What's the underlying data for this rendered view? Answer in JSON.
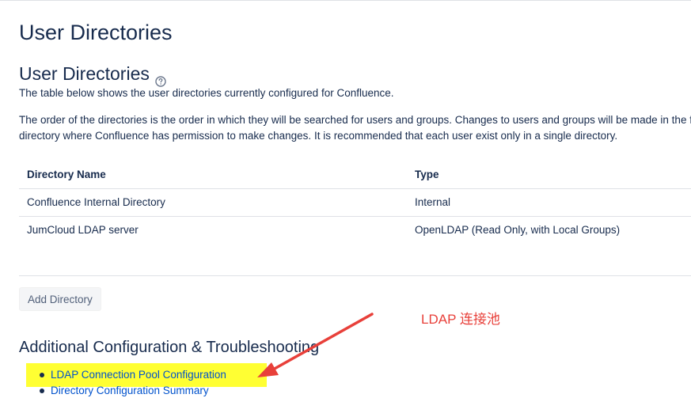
{
  "page": {
    "title": "User Directories"
  },
  "section": {
    "title": "User Directories",
    "help_icon": "question-circle-icon",
    "description_1": "The table below shows the user directories currently configured for Confluence.",
    "description_2_line1": "The order of the directories is the order in which they will be searched for users and groups. Changes to users and groups will be made in the first",
    "description_2_line2": "directory where Confluence has permission to make changes. It is recommended that each user exist only in a single directory."
  },
  "table": {
    "headers": [
      "Directory Name",
      "Type"
    ],
    "rows": [
      {
        "name": "Confluence Internal Directory",
        "type": "Internal"
      },
      {
        "name": "JumCloud LDAP server",
        "type": "OpenLDAP (Read Only, with Local Groups)"
      }
    ]
  },
  "actions": {
    "add_directory": "Add Directory"
  },
  "additional": {
    "title": "Additional Configuration & Troubleshooting",
    "links": [
      "LDAP Connection Pool Configuration",
      "Directory Configuration Summary"
    ]
  },
  "annotation": {
    "text": "LDAP 连接池",
    "color": "#e8403a",
    "highlight_color": "#ffff33"
  },
  "colors": {
    "text": "#172b4d",
    "link": "#0052cc",
    "border": "#dfe1e6"
  }
}
